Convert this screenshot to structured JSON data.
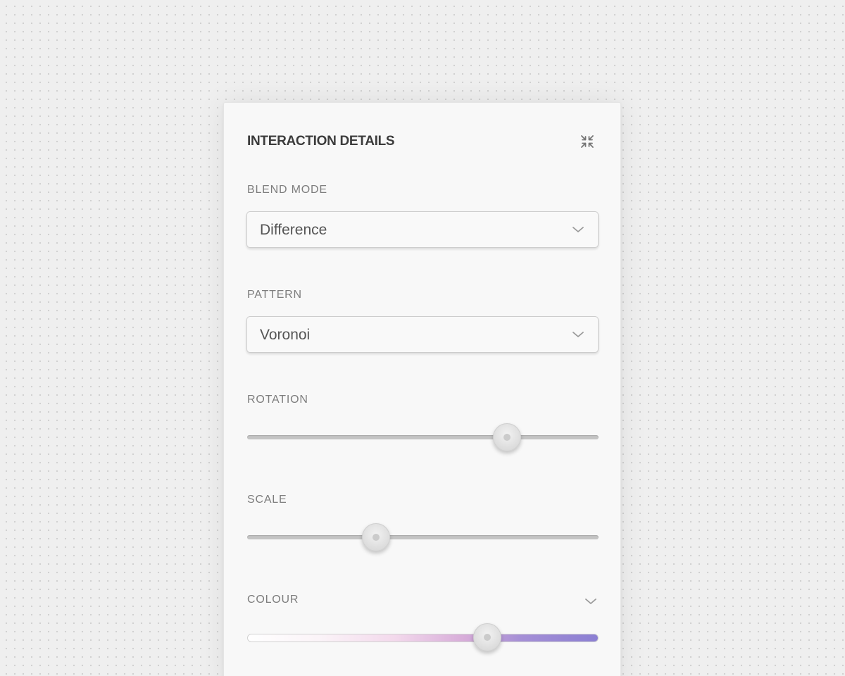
{
  "panel": {
    "title": "INTERACTION DETAILS",
    "collapse_icon": "collapse-arrows-icon"
  },
  "blend_mode": {
    "label": "BLEND MODE",
    "value": "Difference"
  },
  "pattern": {
    "label": "PATTERN",
    "value": "Voronoi"
  },
  "rotation": {
    "label": "ROTATION",
    "value_fraction": 0.74
  },
  "scale": {
    "label": "SCALE",
    "value_fraction": 0.366
  },
  "colour": {
    "label": "COLOUR",
    "value_fraction": 0.683,
    "gradient_colors": [
      "#ffffff",
      "#f3d9ec",
      "#d7acd9",
      "#8b7fd3"
    ]
  },
  "colors": {
    "accent_purple": "#8b7fd3"
  }
}
